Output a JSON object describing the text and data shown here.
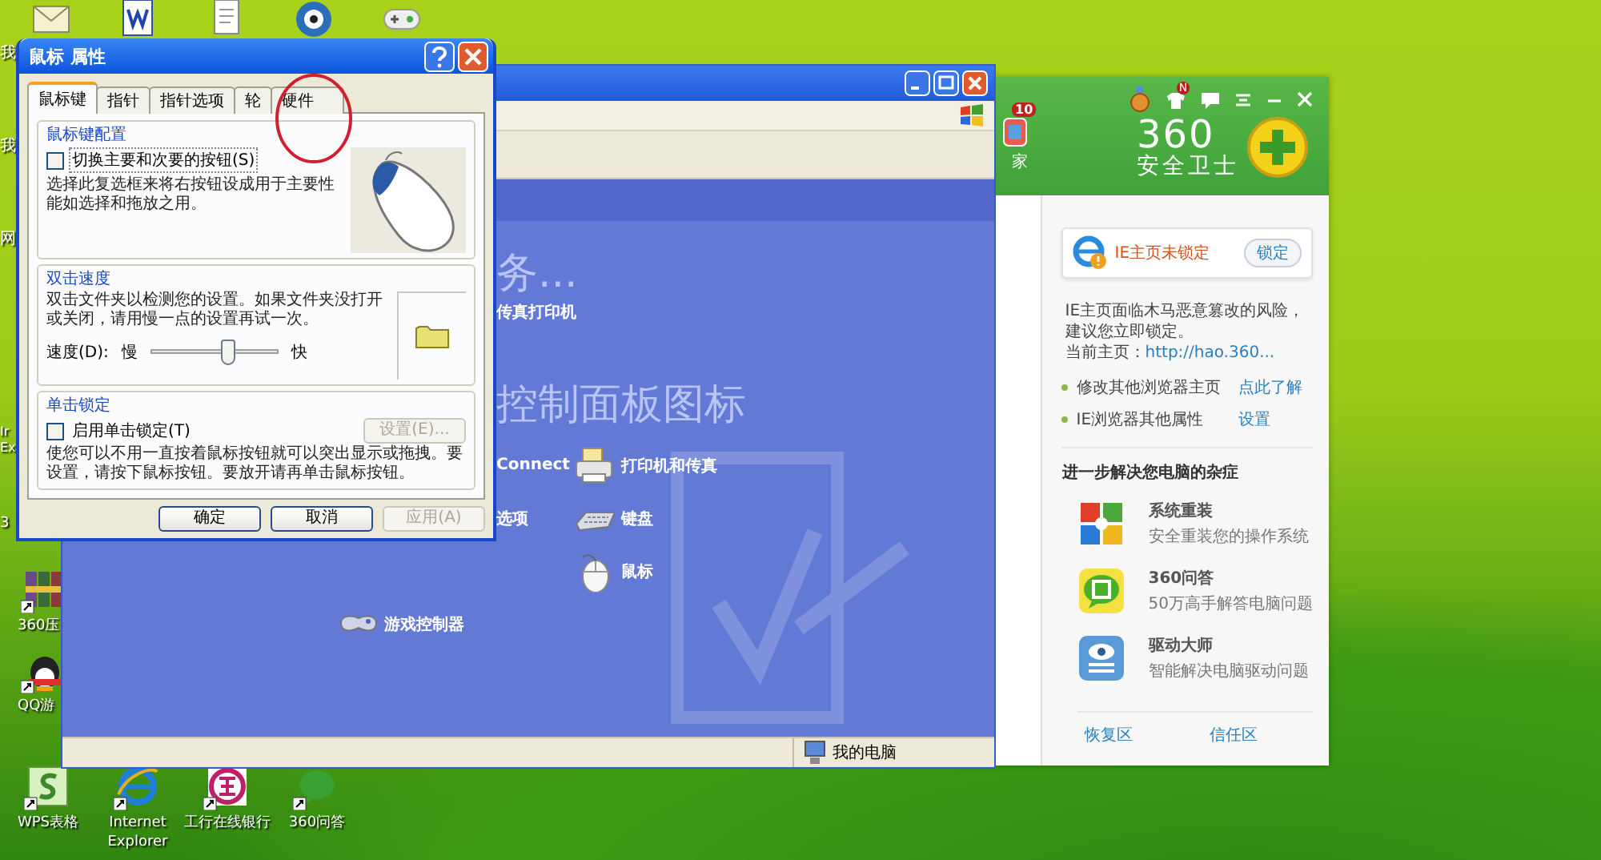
{
  "desktop": {
    "edge_labels": [
      "我",
      "我",
      "网",
      "Ir",
      "Ex",
      "3"
    ],
    "left_icons": [
      {
        "kind": "archive",
        "label": "360压"
      },
      {
        "kind": "game",
        "label": "QQ游"
      }
    ],
    "bottom_icons": [
      {
        "kind": "spreadsheet",
        "label": "WPS表格"
      },
      {
        "kind": "browser",
        "label": "Internet Explorer"
      },
      {
        "kind": "bank",
        "label": "工行在线银行"
      },
      {
        "kind": "qa",
        "label": "360问答"
      }
    ]
  },
  "mouse_dialog": {
    "title": "鼠标 属性",
    "tabs": [
      {
        "label": "鼠标键",
        "selected": true
      },
      {
        "label": "指针",
        "selected": false
      },
      {
        "label": "指针选项",
        "selected": false
      },
      {
        "label": "轮",
        "selected": false
      },
      {
        "label": "硬件",
        "selected": false
      }
    ],
    "button_config": {
      "title": "鼠标键配置",
      "checkbox": {
        "label": "切换主要和次要的按钮(S)",
        "checked": false
      },
      "description": "选择此复选框来将右按钮设成用于主要性能如选择和拖放之用。"
    },
    "double_click": {
      "title": "双击速度",
      "description": "双击文件夹以检测您的设置。如果文件夹没打开或关闭，请用慢一点的设置再试一次。",
      "speed_label": "速度(D):",
      "slow": "慢",
      "fast": "快",
      "level": 0.6
    },
    "click_lock": {
      "title": "单击锁定",
      "checkbox": {
        "label": "启用单击锁定(T)",
        "checked": false
      },
      "settings_button": {
        "label": "设置(E)...",
        "disabled": true
      },
      "description": "使您可以不用一直按着鼠标按钮就可以突出显示或拖拽。要设置，请按下鼠标按钮。要放开请再单击鼠标按钮。"
    },
    "buttons": [
      {
        "label": "确定",
        "disabled": false
      },
      {
        "label": "取消",
        "disabled": false
      },
      {
        "label": "应用(A)",
        "disabled": true
      }
    ]
  },
  "control_panel": {
    "tasks_heading": "务...",
    "task_link": "传真打印机",
    "icons_heading": "控制面板图标",
    "items": [
      {
        "kind": "text",
        "label": "Connect"
      },
      {
        "kind": "printer",
        "label": "打印机和传真"
      },
      {
        "kind": "text",
        "label": "选项"
      },
      {
        "kind": "keyboard",
        "label": "键盘"
      },
      {
        "kind": "mouse",
        "label": "鼠标"
      },
      {
        "kind": "gamepad",
        "label": "游戏控制器"
      }
    ],
    "status_bar": "我的电脑"
  },
  "security_app": {
    "side_badge": "10",
    "side_label": "家",
    "notice_badge": "N",
    "logo_number": "360",
    "logo_name": "安全卫士",
    "alert": {
      "title": "IE主页未锁定",
      "button": "锁定"
    },
    "warning": "IE主页面临木马恶意篡改的风险，建议您立即锁定。",
    "homepage_label": "当前主页：",
    "homepage_url": "http://hao.360...",
    "options": [
      {
        "text": "修改其他浏览器主页",
        "link": "点此了解"
      },
      {
        "text": "IE浏览器其他属性",
        "link": "设置"
      }
    ],
    "section_title": "进一步解决您电脑的杂症",
    "tools": [
      {
        "kind": "reinstall",
        "name": "系统重装",
        "desc": "安全重装您的操作系统"
      },
      {
        "kind": "qa",
        "name": "360问答",
        "desc": "50万高手解答电脑问题"
      },
      {
        "kind": "driver",
        "name": "驱动大师",
        "desc": "智能解决电脑驱动问题"
      }
    ],
    "footer": [
      "恢复区",
      "信任区"
    ]
  }
}
